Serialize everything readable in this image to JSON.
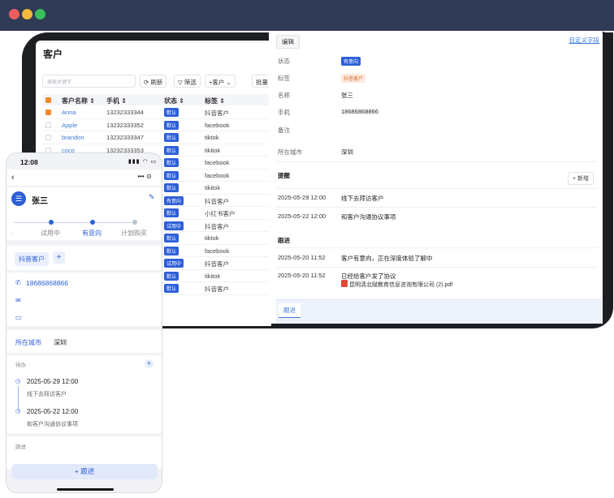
{
  "table_page": {
    "title": "客户",
    "search_placeholder": "搜索关键字",
    "toolbar": {
      "refresh": "⟳ 刷新",
      "filter": "▽ 筛选",
      "add_customer": "+客户  ⌄",
      "batch": "批量"
    },
    "columns": {
      "name": "客户名称 ⇕",
      "phone": "手机 ⇕",
      "status": "状态 ⇕",
      "tag": "标签 ⇕"
    },
    "rows": [
      {
        "name": "Anna",
        "phone": "13232333344",
        "status": "默认",
        "tag": "抖音客户",
        "checked": true
      },
      {
        "name": "Apple",
        "phone": "13232333352",
        "status": "默认",
        "tag": "facebook",
        "checked": false
      },
      {
        "name": "brandon",
        "phone": "13232333347",
        "status": "默认",
        "tag": "tiktok",
        "checked": false
      },
      {
        "name": "coco",
        "phone": "13232333353",
        "status": "默认",
        "tag": "tikitok",
        "checked": false
      },
      {
        "name": "",
        "phone": "",
        "status": "默认",
        "tag": "facebook",
        "checked": false
      },
      {
        "name": "",
        "phone": "",
        "status": "默认",
        "tag": "facebook",
        "checked": false
      },
      {
        "name": "",
        "phone": "",
        "status": "默认",
        "tag": "tikitok",
        "checked": false
      },
      {
        "name": "",
        "phone": "",
        "status": "有意向",
        "tag": "抖音客户",
        "checked": false
      },
      {
        "name": "",
        "phone": "",
        "status": "默认",
        "tag": "小红书客户",
        "checked": false
      },
      {
        "name": "",
        "phone": "",
        "status": "试用中",
        "tag": "抖音客户",
        "checked": false
      },
      {
        "name": "",
        "phone": "",
        "status": "默认",
        "tag": "tiktok",
        "checked": false
      },
      {
        "name": "",
        "phone": "",
        "status": "默认",
        "tag": "facebook",
        "checked": false
      },
      {
        "name": "",
        "phone": "",
        "status": "试用中",
        "tag": "抖音客户",
        "checked": false
      },
      {
        "name": "",
        "phone": "",
        "status": "默认",
        "tag": "tikitok",
        "checked": false
      },
      {
        "name": "",
        "phone": "",
        "status": "默认",
        "tag": "抖音客户",
        "checked": false
      }
    ]
  },
  "detail": {
    "edit_button": "编辑",
    "custom_fields_link": "自定义字段",
    "fields": {
      "status_label": "状态",
      "status_value": "有意向",
      "tag_label": "标签",
      "tag_value": "抖音客户",
      "name_label": "名称",
      "name_value": "张三",
      "phone_label": "手机",
      "phone_value": "18686868866",
      "note_label": "备注",
      "city_label": "所在城市",
      "city_value": "深圳"
    },
    "reminders": {
      "title": "提醒",
      "add_button": "+ 新增",
      "items": [
        {
          "time": "2025-05-29 12:00",
          "text": "线下去拜访客户"
        },
        {
          "time": "2025-05-22 12:00",
          "text": "和客户沟通协议事项"
        }
      ]
    },
    "followups": {
      "title": "跟进",
      "items": [
        {
          "time": "2025-05-20 11:52",
          "text": "客户有意向，正在深度体验了解中"
        },
        {
          "time": "2025-05-20 11:52",
          "text": "已经给客户发了协议"
        }
      ],
      "attachment": "昆明清北赋教育信息咨询有限公司 (2).pdf"
    },
    "bottom_tab": "跟进"
  },
  "phone": {
    "time": "12:08",
    "status_icons": "▮▮▮ ◠ ▭",
    "back": "‹",
    "capsule": "•••  ⊙",
    "avatar_glyph": "☰",
    "name": "张三",
    "stages": {
      "prev": ".",
      "trial": "试用中",
      "intent": "有意向",
      "plan": "计划购买"
    },
    "tag_chip": "抖音客户",
    "add_tag": "+",
    "phone_number": "18686868866",
    "city_label": "所在城市",
    "city_value": "深圳",
    "todo_label": "待办",
    "todo_add": "+",
    "todos": [
      {
        "time": "2025-05-29 12:00",
        "text": "线下去拜访客户"
      },
      {
        "time": "2025-05-22 12:00",
        "text": "和客户沟通协议事项"
      }
    ],
    "followup_label": "跟进",
    "followup_button": "+ 跟进"
  },
  "colors": {
    "accent": "#2d5fd6",
    "titlebar": "#2f3a55",
    "checkbox_checked": "#f28a2c",
    "tag_orange": "#d96b2c"
  }
}
